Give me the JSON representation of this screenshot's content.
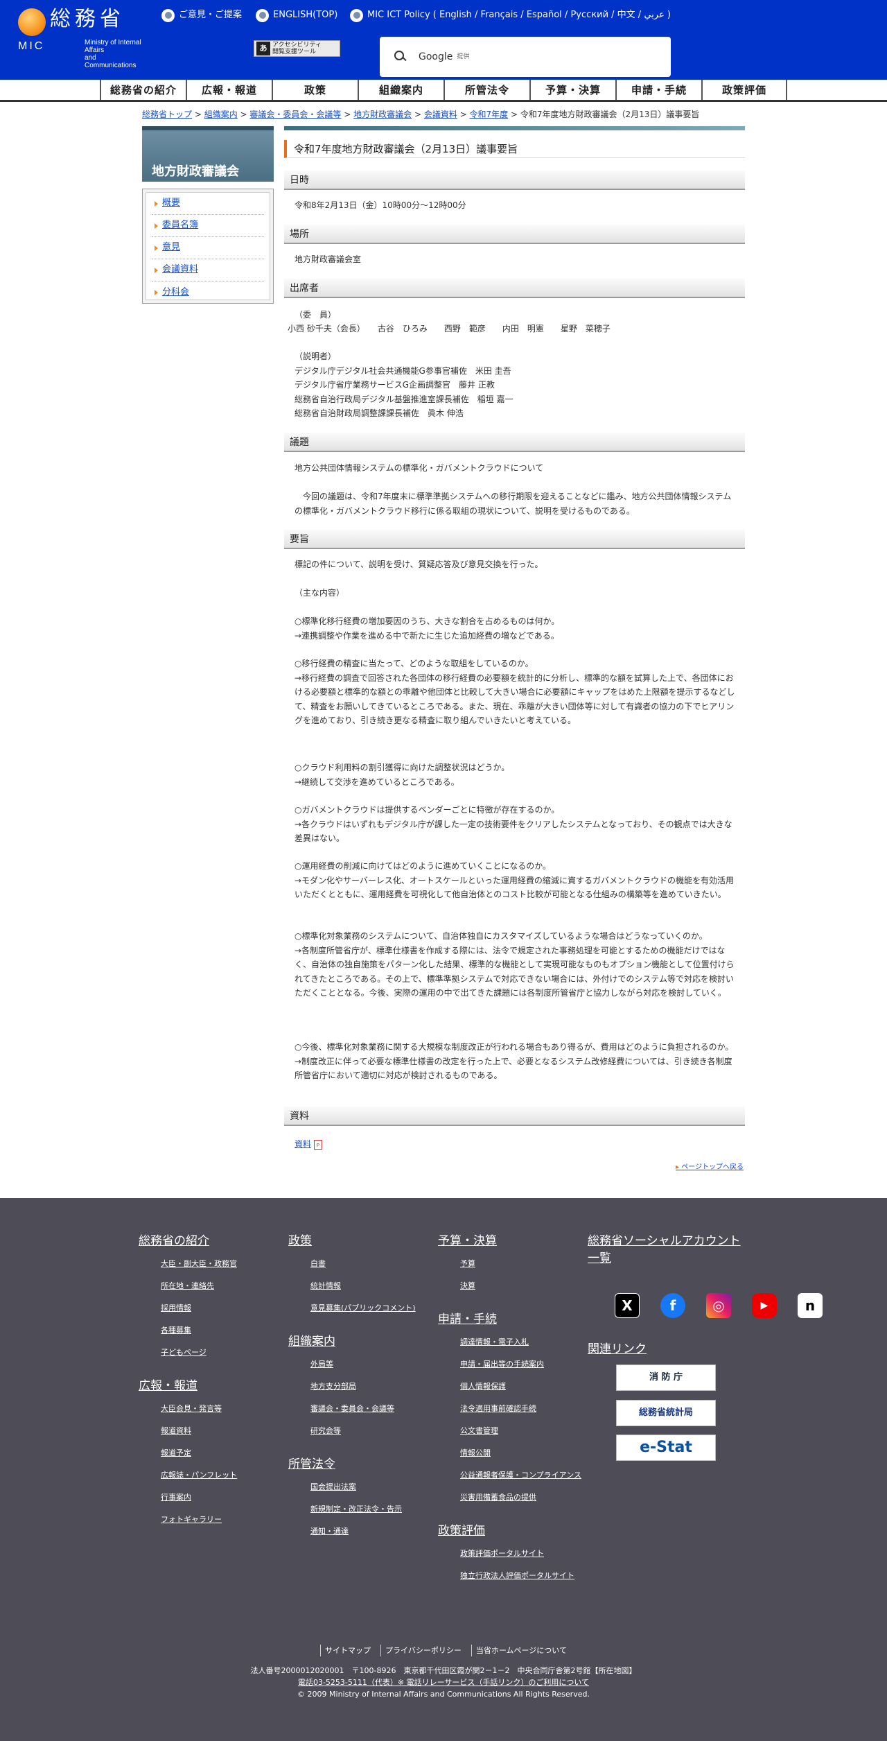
{
  "header": {
    "logo_jp": "総務省",
    "logo_mic": "MIC",
    "logo_en_1": "Ministry of Internal Affairs",
    "logo_en_2": "and Communications",
    "radios": [
      "ご意見・ご提案",
      "ENGLISH(TOP)",
      "MIC ICT Policy ( English / Français / Español / Русский / 中文 / عربي )"
    ],
    "accessibility_1": "アクセシビリティ",
    "accessibility_2": "閲覧支援ツール",
    "search_brand": "Google",
    "search_suffix": "提供"
  },
  "gnav": [
    "総務省の紹介",
    "広報・報道",
    "政策",
    "組織案内",
    "所管法令",
    "予算・決算",
    "申請・手続",
    "政策評価"
  ],
  "breadcrumb": {
    "links": [
      "総務省トップ",
      "組織案内",
      "審議会・委員会・会議等",
      "地方財政審議会",
      "会議資料",
      "令和7年度"
    ],
    "sep": " > ",
    "current": "令和7年度地方財政審議会（2月13日）議事要旨"
  },
  "side": {
    "title": "地方財政審議会",
    "items": [
      "概要",
      "委員名簿",
      "意見",
      "会議資料",
      "分科会"
    ]
  },
  "main": {
    "title": "令和7年度地方財政審議会（2月13日）議事要旨",
    "s1": "日時",
    "t1": "令和8年2月13日（金）10時00分～12時00分",
    "s2": "場所",
    "t2": "地方財政審議会室",
    "s3": "出席者",
    "t3a": "（委　員）",
    "t3b": "小西 砂千夫（会長）　　古谷　ひろみ　　西野　範彦　　内田　明憲　　星野　菜穂子",
    "t3c": "（説明者）\nデジタル庁デジタル社会共通機能G参事官補佐　米田 圭吾\nデジタル庁省庁業務サービスG企画調整官　藤井 正教\n総務省自治行政局デジタル基盤推進室課長補佐　稲垣 嘉一\n総務省自治財政局調整課課長補佐　眞木 伸浩",
    "s4": "議題",
    "t4a": "地方公共団体情報システムの標準化・ガバメントクラウドについて",
    "t4b": "　今回の議題は、令和7年度末に標準準拠システムへの移行期限を迎えることなどに鑑み、地方公共団体情報システムの標準化・ガバメントクラウド移行に係る取組の現状について、説明を受けるものである。",
    "s5": "要旨",
    "t5a": "標記の件について、説明を受け、質疑応答及び意見交換を行った。",
    "t5b": "（主な内容）",
    "t5c": "○標準化移行経費の増加要因のうち、大きな割合を占めるものは何か。\n→連携調整や作業を進める中で新たに生じた追加経費の増などである。",
    "t5d": "○移行経費の精査に当たって、どのような取組をしているのか。\n→移行経費の調査で回答された各団体の移行経費の必要額を統計的に分析し、標準的な額を試算した上で、各団体における必要額と標準的な額との乖離や他団体と比較して大きい場合に必要額にキャップをはめた上限額を提示するなどして、精査をお願いしてきているところである。また、現在、乖離が大きい団体等に対して有識者の協力の下でヒアリングを進めており、引き続き更なる精査に取り組んでいきたいと考えている。",
    "t5e": "○クラウド利用料の割引獲得に向けた調整状況はどうか。\n→継続して交渉を進めているところである。",
    "t5f": "○ガバメントクラウドは提供するベンダーごとに特徴が存在するのか。\n→各クラウドはいずれもデジタル庁が課した一定の技術要件をクリアしたシステムとなっており、その観点では大きな差異はない。",
    "t5g": "○運用経費の削減に向けてはどのように進めていくことになるのか。\n→モダン化やサーバーレス化、オートスケールといった運用経費の縮減に資するガバメントクラウドの機能を有効活用いただくとともに、運用経費を可視化して他自治体とのコスト比較が可能となる仕組みの構築等を進めていきたい。",
    "t5h": "○標準化対象業務のシステムについて、自治体独自にカスタマイズしているような場合はどうなっていくのか。\n→各制度所管省庁が、標準仕様書を作成する際には、法令で規定された事務処理を可能とするための機能だけではなく、自治体の独自施策をパターン化した結果、標準的な機能として実現可能なものもオプション機能として位置付けられてきたところである。その上で、標準準拠システムで対応できない場合には、外付けでのシステム等で対応を検討いただくこととなる。今後、実際の運用の中で出てきた課題には各制度所管省庁と協力しながら対応を検討していく。",
    "t5i": "○今後、標準化対象業務に関する大規模な制度改正が行われる場合もあり得るが、費用はどのように負担されるのか。\n→制度改正に伴って必要な標準仕様書の改定を行った上で、必要となるシステム改修経費については、引き続き各制度所管省庁において適切に対応が検討されるものである。",
    "s6": "資料",
    "t6": "資料",
    "pagetop": "ページトップへ戻る"
  },
  "footer": {
    "col1": {
      "h1": "総務省の紹介",
      "l1": [
        "大臣・副大臣・政務官",
        "所在地・連絡先",
        "採用情報",
        "各種募集",
        "子どもページ"
      ],
      "h2": "広報・報道",
      "l2": [
        "大臣会見・発言等",
        "報道資料",
        "報道予定",
        "広報誌・パンフレット",
        "行事案内",
        "フォトギャラリー"
      ]
    },
    "col2": {
      "h1": "政策",
      "l1": [
        "白書",
        "統計情報",
        "意見募集(パブリックコメント)"
      ],
      "h2": "組織案内",
      "l2": [
        "外局等",
        "地方支分部局",
        "審議会・委員会・会議等",
        "研究会等"
      ],
      "h3": "所管法令",
      "l3": [
        "国会提出法案",
        "新規制定・改正法令・告示",
        "通知・通達"
      ]
    },
    "col3": {
      "h1": "予算・決算",
      "l1": [
        "予算",
        "決算"
      ],
      "h2": "申請・手続",
      "l2": [
        "調達情報・電子入札",
        "申請・届出等の手続案内",
        "個人情報保護",
        "法令適用事前確認手続",
        "公文書管理",
        "情報公開",
        "公益通報者保護・コンプライアンス",
        "災害用備蓄食品の提供"
      ],
      "h3": "政策評価",
      "l3": [
        "政策評価ポータルサイト",
        "独立行政法人評価ポータルサイト"
      ]
    },
    "col4": {
      "h1": "総務省ソーシャルアカウント一覧",
      "h2": "関連リンク",
      "banners": [
        "消 防 庁",
        "総務省統計局",
        "e-Stat"
      ]
    },
    "bottom_links": [
      "サイトマップ",
      "プライバシーポリシー",
      "当省ホームページについて"
    ],
    "address": "法人番号2000012020001　〒100-8926　東京都千代田区霞が関2－1－2　中央合同庁舎第2号館【所在地図】",
    "tel": "電話03-5253-5111（代表）※ 電話リレーサービス（手話リンク）のご利用について",
    "copyright": "© 2009 Ministry of Internal Affairs and Communications All Rights Reserved."
  }
}
